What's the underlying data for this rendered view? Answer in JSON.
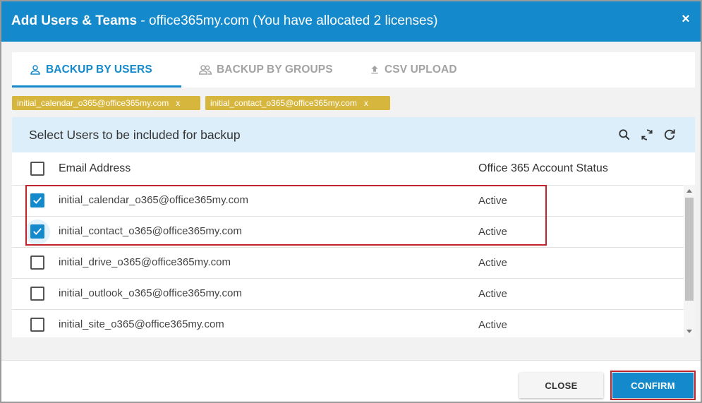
{
  "dialog": {
    "title_bold": "Add Users & Teams",
    "title_rest": " - office365my.com (You have allocated 2 licenses)",
    "close_glyph": "×"
  },
  "tabs": [
    {
      "label": "BACKUP BY USERS",
      "icon": "user-icon",
      "active": true
    },
    {
      "label": "BACKUP BY GROUPS",
      "icon": "group-icon",
      "active": false
    },
    {
      "label": "CSV UPLOAD",
      "icon": "upload-icon",
      "active": false
    }
  ],
  "selected_chips": [
    {
      "label": "initial_calendar_o365@office365my.com",
      "remove": "x"
    },
    {
      "label": "initial_contact_o365@office365my.com",
      "remove": "x"
    }
  ],
  "panel": {
    "title": "Select Users to be included for backup",
    "icons": [
      "search-icon",
      "sync-icon",
      "refresh-icon"
    ],
    "columns": {
      "email": "Email Address",
      "status": "Office 365 Account Status"
    },
    "rows": [
      {
        "email": "initial_calendar_o365@office365my.com",
        "status": "Active",
        "checked": true
      },
      {
        "email": "initial_contact_o365@office365my.com",
        "status": "Active",
        "checked": true
      },
      {
        "email": "initial_drive_o365@office365my.com",
        "status": "Active",
        "checked": false
      },
      {
        "email": "initial_outlook_o365@office365my.com",
        "status": "Active",
        "checked": false
      },
      {
        "email": "initial_site_o365@office365my.com",
        "status": "Active",
        "checked": false
      }
    ]
  },
  "footer": {
    "close_label": "CLOSE",
    "confirm_label": "CONFIRM"
  },
  "colors": {
    "accent": "#1489cc",
    "chip": "#d6b63c",
    "header_bg": "#dbeefa",
    "highlight": "#c0242d"
  }
}
